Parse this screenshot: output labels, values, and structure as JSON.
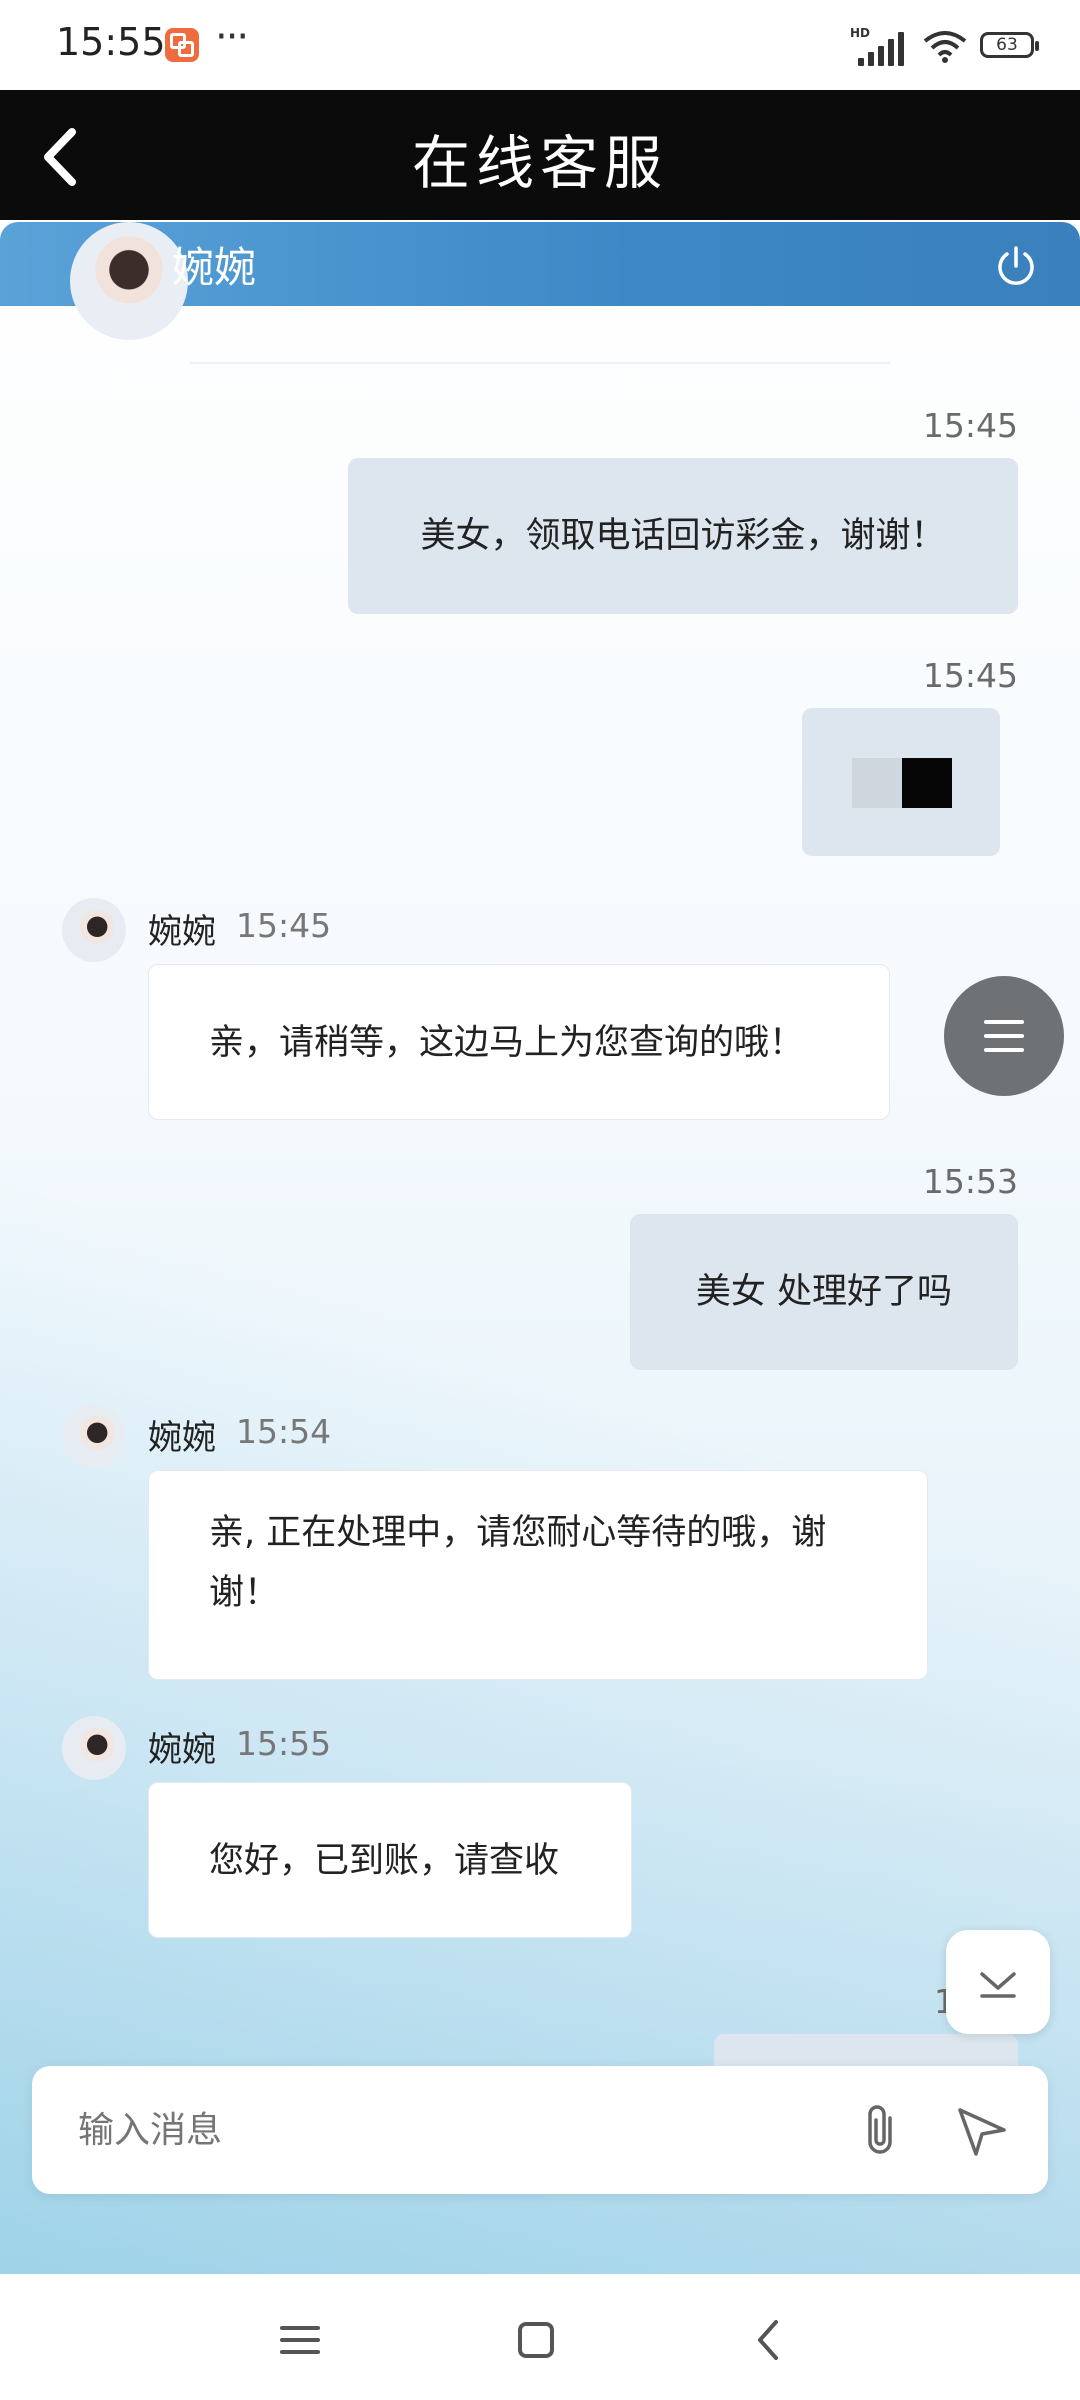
{
  "status_bar": {
    "time": "15:55",
    "more": "···",
    "network_label": "HD",
    "battery": "63"
  },
  "header": {
    "title": "在线客服",
    "back_icon": "chevron-left-icon"
  },
  "agent": {
    "name": "婉婉",
    "power_icon": "power-icon"
  },
  "messages": [
    {
      "side": "sent",
      "time": "15:45",
      "text": "美女，领取电话回访彩金，谢谢！"
    },
    {
      "side": "sent",
      "time": "15:45",
      "type": "image"
    },
    {
      "side": "received",
      "name": "婉婉",
      "time": "15:45",
      "text": "亲，请稍等，这边马上为您查询的哦！"
    },
    {
      "side": "sent",
      "time": "15:53",
      "text": "美女 处理好了吗"
    },
    {
      "side": "received",
      "name": "婉婉",
      "time": "15:54",
      "text": "亲, 正在处理中，请您耐心等待的哦，谢谢！"
    },
    {
      "side": "received",
      "name": "婉婉",
      "time": "15:55",
      "text": "您好，已到账，请查收"
    },
    {
      "side": "sent",
      "time_partial": "1"
    }
  ],
  "input": {
    "placeholder": "输入消息"
  },
  "colors": {
    "header_bg": "#0b0b0b",
    "agent_bar": "#3c88c6",
    "sent_bubble": "#dde6ee",
    "received_bubble": "#ffffff",
    "fab": "#6f7275"
  }
}
